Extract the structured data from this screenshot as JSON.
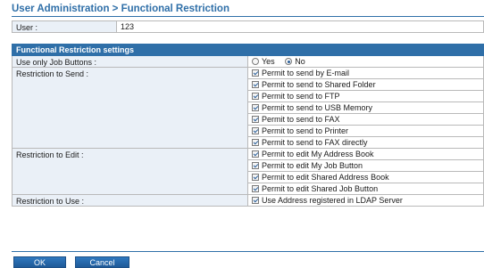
{
  "page": {
    "title": "User Administration > Functional Restriction"
  },
  "user": {
    "label": "User :",
    "value": "123"
  },
  "settings": {
    "header": "Functional Restriction settings",
    "use_only_job_buttons": {
      "label": "Use only Job Buttons :",
      "options": [
        {
          "label": "Yes",
          "selected": false
        },
        {
          "label": "No",
          "selected": true
        }
      ]
    },
    "restriction_to_send": {
      "label": "Restriction to Send :",
      "items": [
        {
          "label": "Permit to send by E-mail",
          "checked": true
        },
        {
          "label": "Permit to send to Shared Folder",
          "checked": true
        },
        {
          "label": "Permit to send to FTP",
          "checked": true
        },
        {
          "label": "Permit to send to USB Memory",
          "checked": true
        },
        {
          "label": "Permit to send to FAX",
          "checked": true
        },
        {
          "label": "Permit to send to Printer",
          "checked": true
        },
        {
          "label": "Permit to send to FAX directly",
          "checked": true
        }
      ]
    },
    "restriction_to_edit": {
      "label": "Restriction to Edit :",
      "items": [
        {
          "label": "Permit to edit My Address Book",
          "checked": true
        },
        {
          "label": "Permit to edit My Job Button",
          "checked": true
        },
        {
          "label": "Permit to edit Shared Address Book",
          "checked": true
        },
        {
          "label": "Permit to edit Shared Job Button",
          "checked": true
        }
      ]
    },
    "restriction_to_use": {
      "label": "Restriction to Use :",
      "items": [
        {
          "label": "Use Address registered in LDAP Server",
          "checked": true
        }
      ]
    }
  },
  "buttons": {
    "ok": "OK",
    "cancel": "Cancel"
  }
}
